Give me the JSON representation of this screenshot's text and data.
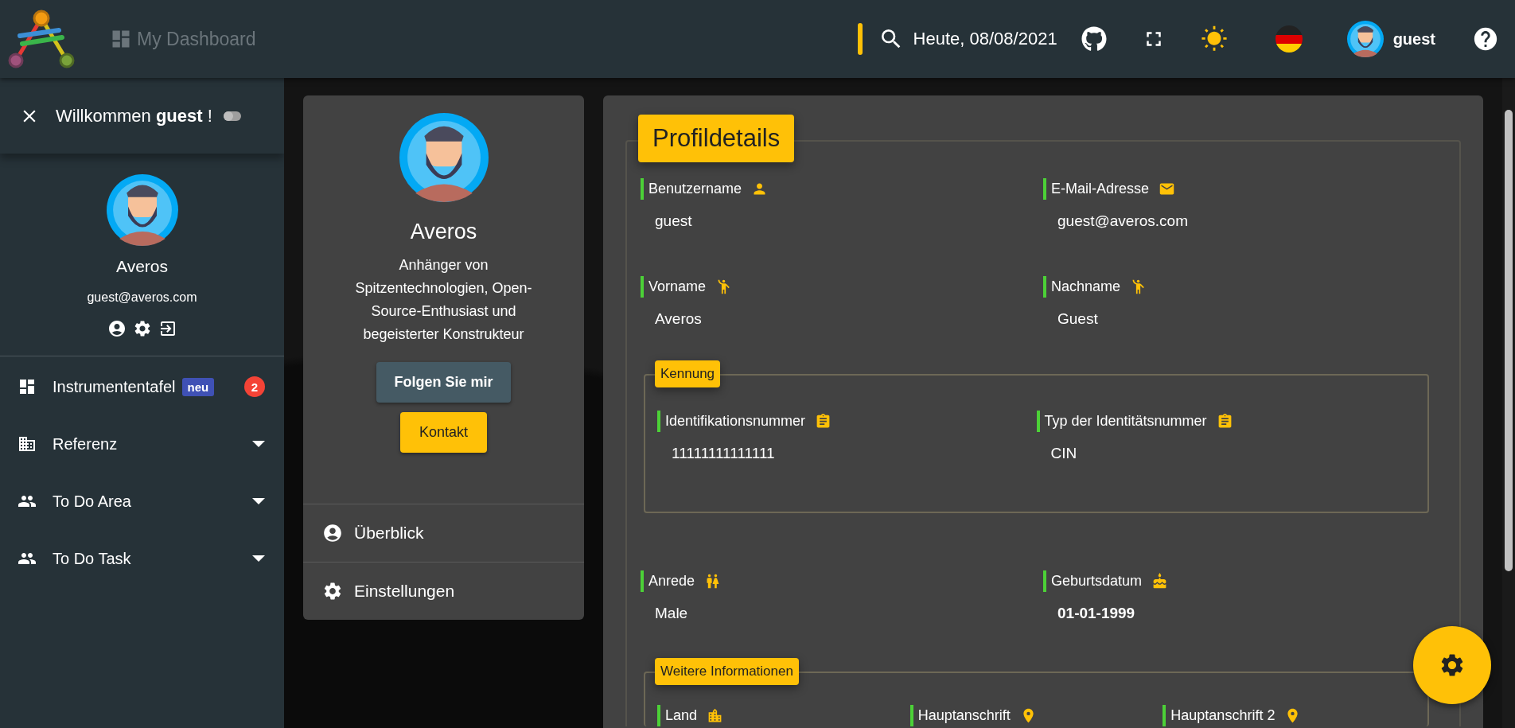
{
  "header": {
    "title": "My Dashboard",
    "date": "Heute, 08/08/2021",
    "user": "guest"
  },
  "sidebar": {
    "welcome": "Willkommen **guest** !",
    "toggle": {
      "on": false
    },
    "name": "Averos",
    "email": "guest@averos.com",
    "menu": [
      {
        "label": "Instrumententafel",
        "badge": "neu",
        "count": "2",
        "expandable": false
      },
      {
        "label": "Referenz",
        "expandable": true
      },
      {
        "label": "To Do Area",
        "expandable": true
      },
      {
        "label": "To Do Task",
        "expandable": true
      }
    ]
  },
  "profile_card": {
    "name": "Averos",
    "bio": "Anhänger von Spitzentechnologien, Open-Source-Enthusiast und begeisterter Konstrukteur",
    "buttons": [
      {
        "label": "Folgen Sie mir",
        "kind": "secondary"
      },
      {
        "label": "Kontakt",
        "kind": "primary"
      }
    ],
    "links": [
      "Überblick",
      "Einstellungen"
    ]
  },
  "details": {
    "title": "Profildetails",
    "blocks": [
      {
        "kind": "fields",
        "fields": [
          {
            "label": "Benutzername",
            "value": "guest",
            "bold": false
          },
          {
            "label": "E-Mail-Adresse",
            "value": "guest@averos.com",
            "bold": false
          },
          {
            "label": "Vorname",
            "value": "Averos",
            "bold": false
          },
          {
            "label": "Nachname",
            "value": "Guest",
            "bold": false
          }
        ]
      },
      {
        "kind": "section",
        "title": "Kennung",
        "fields": [
          {
            "label": "Identifikationsnummer",
            "value": "11111111111111",
            "bold": false
          },
          {
            "label": "Typ der Identitätsnummer",
            "value": "CIN",
            "bold": false
          }
        ]
      },
      {
        "kind": "fields",
        "fields": [
          {
            "label": "Anrede",
            "value": "Male",
            "bold": false
          },
          {
            "label": "Geburtsdatum",
            "value": "01-01-1999",
            "bold": true
          }
        ]
      },
      {
        "kind": "section",
        "title": "Weitere Informationen",
        "fields": [
          {
            "label": "Land"
          },
          {
            "label": "Hauptanschrift"
          },
          {
            "label": "Hauptanschrift 2"
          }
        ]
      }
    ]
  }
}
